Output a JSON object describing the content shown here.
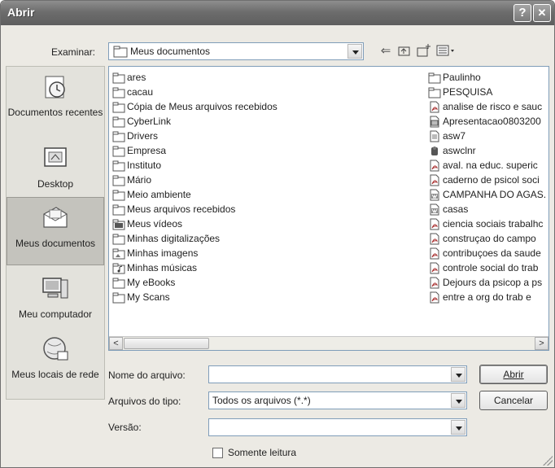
{
  "window": {
    "title": "Abrir",
    "help_label": "?",
    "close_label": "✕"
  },
  "lookin": {
    "label": "Examinar:",
    "value": "Meus documentos"
  },
  "toolbar": {
    "back_icon": "back-arrow-icon",
    "up_icon": "folder-up-icon",
    "new_icon": "new-folder-icon",
    "views_icon": "views-menu-icon"
  },
  "places": [
    {
      "label": "Documentos recentes",
      "icon": "recent-documents-icon"
    },
    {
      "label": "Desktop",
      "icon": "desktop-icon"
    },
    {
      "label": "Meus documentos",
      "icon": "my-documents-icon"
    },
    {
      "label": "Meu computador",
      "icon": "my-computer-icon"
    },
    {
      "label": "Meus locais de rede",
      "icon": "network-places-icon"
    }
  ],
  "files_left": [
    {
      "name": "ares",
      "icon": "folder-icon"
    },
    {
      "name": "cacau",
      "icon": "folder-icon"
    },
    {
      "name": "Cópia de Meus arquivos recebidos",
      "icon": "folder-icon"
    },
    {
      "name": "CyberLink",
      "icon": "folder-icon"
    },
    {
      "name": "Drivers",
      "icon": "folder-icon"
    },
    {
      "name": "Empresa",
      "icon": "folder-icon"
    },
    {
      "name": "Instituto",
      "icon": "folder-icon"
    },
    {
      "name": "Mário",
      "icon": "folder-icon"
    },
    {
      "name": "Meio ambiente",
      "icon": "folder-icon"
    },
    {
      "name": "Meus arquivos recebidos",
      "icon": "folder-icon"
    },
    {
      "name": "Meus vídeos",
      "icon": "video-folder-icon"
    },
    {
      "name": "Minhas digitalizações",
      "icon": "folder-icon"
    },
    {
      "name": "Minhas imagens",
      "icon": "pictures-folder-icon"
    },
    {
      "name": "Minhas músicas",
      "icon": "music-folder-icon"
    },
    {
      "name": "My eBooks",
      "icon": "folder-icon"
    },
    {
      "name": "My Scans",
      "icon": "folder-icon"
    }
  ],
  "files_right": [
    {
      "name": "Paulinho",
      "icon": "folder-icon"
    },
    {
      "name": "PESQUISA",
      "icon": "folder-icon"
    },
    {
      "name": "analise de risco e sauc",
      "icon": "pdf-file-icon"
    },
    {
      "name": "Apresentacao0803200",
      "icon": "image-file-icon"
    },
    {
      "name": "asw7",
      "icon": "text-file-icon"
    },
    {
      "name": "aswclnr",
      "icon": "app-file-icon"
    },
    {
      "name": "aval. na educ. superic",
      "icon": "pdf-file-icon"
    },
    {
      "name": "caderno de psicol soci",
      "icon": "pdf-file-icon"
    },
    {
      "name": "CAMPANHA DO AGAS.",
      "icon": "word-file-icon"
    },
    {
      "name": "casas",
      "icon": "word-file-icon"
    },
    {
      "name": "ciencia sociais trabalhc",
      "icon": "pdf-file-icon"
    },
    {
      "name": "construçao do campo",
      "icon": "pdf-file-icon"
    },
    {
      "name": "contribuçoes da saude",
      "icon": "pdf-file-icon"
    },
    {
      "name": "controle social do trab",
      "icon": "pdf-file-icon"
    },
    {
      "name": "Dejours da psicop a ps",
      "icon": "pdf-file-icon"
    },
    {
      "name": "entre a org do trab e",
      "icon": "pdf-file-icon"
    }
  ],
  "scroll": {
    "left": "<",
    "right": ">"
  },
  "filename": {
    "label": "Nome do arquivo:",
    "value": ""
  },
  "filetype": {
    "label": "Arquivos do tipo:",
    "value": "Todos os arquivos (*.*)"
  },
  "version": {
    "label": "Versão:",
    "value": ""
  },
  "readonly": {
    "label": "Somente leitura",
    "checked": false
  },
  "buttons": {
    "open": "Abrir",
    "cancel": "Cancelar"
  }
}
